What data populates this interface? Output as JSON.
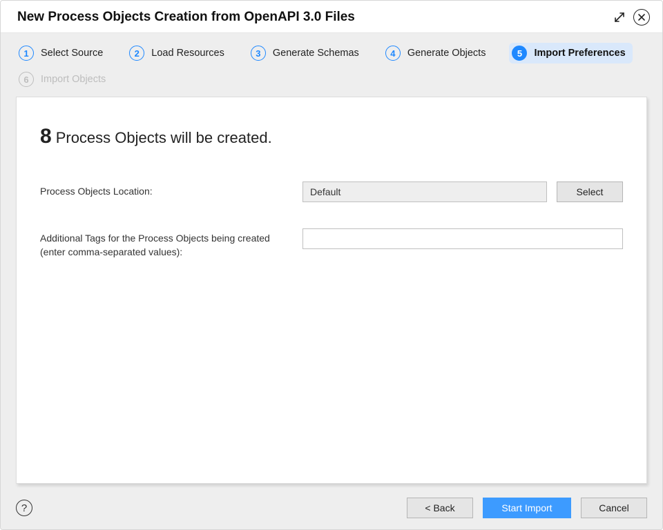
{
  "dialog": {
    "title": "New Process Objects Creation from OpenAPI 3.0 Files"
  },
  "steps": [
    {
      "num": "1",
      "label": "Select Source",
      "state": "done"
    },
    {
      "num": "2",
      "label": "Load Resources",
      "state": "done"
    },
    {
      "num": "3",
      "label": "Generate Schemas",
      "state": "done"
    },
    {
      "num": "4",
      "label": "Generate Objects",
      "state": "done"
    },
    {
      "num": "5",
      "label": "Import Preferences",
      "state": "active"
    },
    {
      "num": "6",
      "label": "Import Objects",
      "state": "future"
    }
  ],
  "summary": {
    "count": "8",
    "text": "Process Objects will be created."
  },
  "form": {
    "location_label": "Process Objects Location:",
    "location_value": "Default",
    "select_button": "Select",
    "tags_label": "Additional Tags for the Process Objects being created (enter comma-separated values):",
    "tags_value": ""
  },
  "footer": {
    "back": "< Back",
    "start": "Start Import",
    "cancel": "Cancel"
  }
}
